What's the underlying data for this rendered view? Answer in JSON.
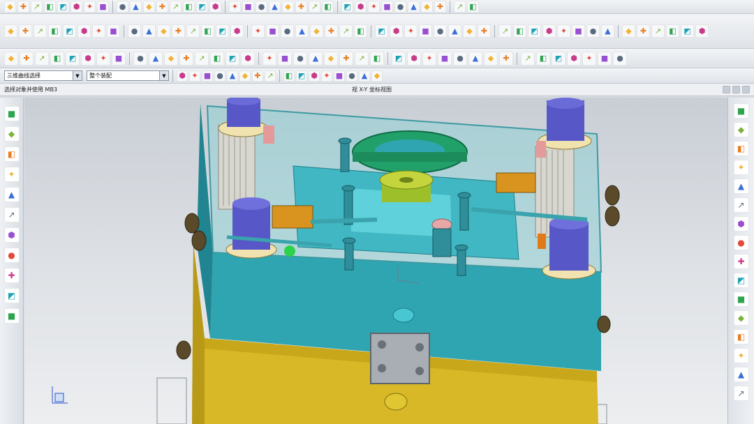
{
  "toolbar_row1": {
    "icons": [
      "new-file-icon",
      "open-icon",
      "save-icon",
      "print-icon",
      "cut-icon",
      "copy-icon",
      "paste-icon",
      "undo-icon",
      "redo-icon",
      "delete-icon",
      "properties-icon",
      "layer-icon",
      "view-icon",
      "zoom-icon",
      "pan-icon",
      "rotate-icon",
      "fit-icon",
      "shade-icon",
      "wireframe-icon",
      "hide-icon",
      "show-icon",
      "sketch-icon",
      "extrude-icon",
      "revolve-icon",
      "hole-icon",
      "boss-icon",
      "pocket-icon",
      "pad-icon",
      "slot-icon",
      "groove-icon",
      "blend-icon",
      "chamfer-icon",
      "shell-icon",
      "draft-icon"
    ]
  },
  "toolbar_row2": {
    "icons": [
      "point-icon",
      "line-icon",
      "arc-icon",
      "circle-icon",
      "fillet-icon",
      "rectangle-icon",
      "polygon-icon",
      "ellipse-icon",
      "spline-icon",
      "offset-icon",
      "trim-icon",
      "extend-icon",
      "mirror-icon",
      "pattern-icon",
      "move-icon",
      "copy-object-icon",
      "align-icon",
      "measure-icon",
      "analyze-icon",
      "section-icon",
      "datum-plane-icon",
      "datum-axis-icon",
      "csys-icon",
      "layer-settings-icon",
      "close-icon",
      "edit-icon",
      "lock-icon",
      "unlock-icon",
      "tag-icon",
      "note-icon",
      "dimension-icon",
      "gdt-icon",
      "surface-icon",
      "mesh-icon",
      "sew-icon",
      "trim-body-icon",
      "split-body-icon",
      "unite-icon",
      "subtract-icon",
      "intersect-icon",
      "replace-face-icon",
      "offset-face-icon",
      "move-face-icon",
      "delete-face-icon",
      "resize-icon",
      "window-icon"
    ]
  },
  "toolbar_row3": {
    "icons": [
      "mold-wizard-icon",
      "init-project-icon",
      "mold-csys-icon",
      "shrinkage-icon",
      "workpiece-icon",
      "layout-icon",
      "parting-icon",
      "mold-base-icon",
      "standard-part-icon",
      "ejector-pin-icon",
      "slider-icon",
      "sub-insert-icon",
      "gate-icon",
      "runner-icon",
      "cooling-icon",
      "electrode-icon",
      "trim-mold-icon",
      "pocket-mold-icon",
      "bom-icon",
      "drawing-icon",
      "view-manager-icon",
      "tooling-icon",
      "component-icon",
      "assembly-icon",
      "constraint-icon",
      "exploded-icon",
      "sequence-icon",
      "clearance-icon",
      "interference-icon",
      "weight-icon",
      "render-icon",
      "material-icon",
      "light-icon",
      "camera-icon",
      "animate-icon",
      "motion-icon",
      "mechanism-icon",
      "routing-icon",
      "harness-icon"
    ]
  },
  "toolbar_row4": {
    "selection_filter": "三维曲线选择",
    "selection_scope": "整个装配",
    "icons": [
      "snap-icon",
      "filter-icon",
      "select-all-icon",
      "deselect-icon",
      "box-select-icon",
      "lasso-icon",
      "point-snap-icon",
      "end-snap-icon",
      "mid-snap-icon",
      "center-snap-icon",
      "quadrant-snap-icon",
      "intersect-snap-icon",
      "existing-point-icon",
      "on-curve-icon",
      "on-face-icon",
      "view-orient-icon"
    ]
  },
  "status": {
    "left_text": "选择对象并使用 MB3",
    "center_text": "视 X-Y 坐标视图"
  },
  "left_sidebar": {
    "icons": [
      "assembly-navigator-icon",
      "part-navigator-icon",
      "reuse-library-icon",
      "web-browser-icon",
      "history-icon",
      "system-materials-icon",
      "process-studio-icon",
      "manufacturing-wizard-icon",
      "roles-icon",
      "system-scenes-icon",
      "help-icon"
    ]
  },
  "right_sidebar": {
    "icons": [
      "mold-init-icon",
      "mold-csys-tool-icon",
      "shrink-tool-icon",
      "workpiece-tool-icon",
      "cavity-layout-icon",
      "family-mold-icon",
      "mold-tools-icon",
      "sub-insert-tool-icon",
      "parting-line-icon",
      "patch-tool-icon",
      "mold-base-tool-icon",
      "standard-tool-icon",
      "ejector-tool-icon",
      "slider-tool-icon",
      "gate-tool-icon",
      "runner-tool-icon"
    ]
  },
  "viewport": {
    "label": "3D mold assembly view"
  }
}
